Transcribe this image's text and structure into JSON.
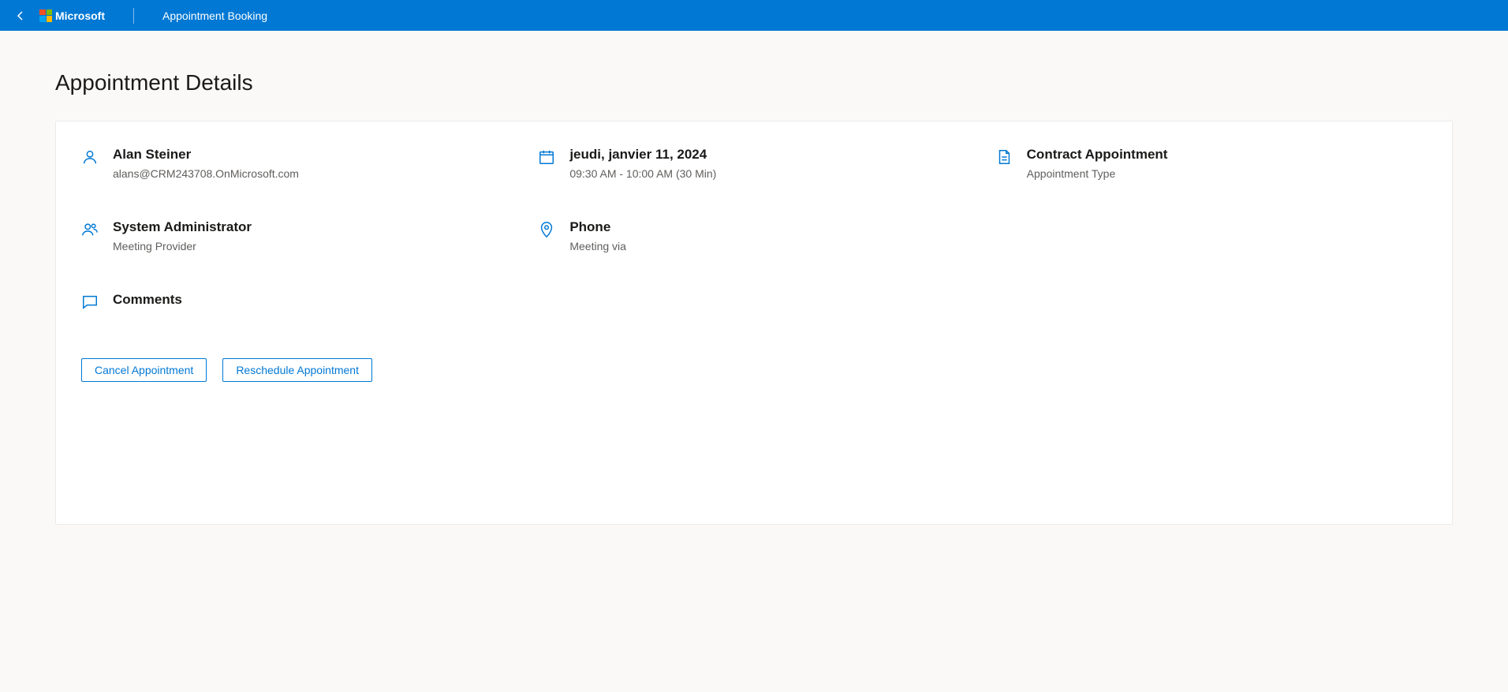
{
  "header": {
    "brand": "Microsoft",
    "title": "Appointment Booking"
  },
  "page_title": "Appointment Details",
  "details": {
    "person": {
      "name": "Alan Steiner",
      "email": "alans@CRM243708.OnMicrosoft.com"
    },
    "date": {
      "date_str": "jeudi, janvier 11, 2024",
      "time_str": "09:30 AM - 10:00 AM (30 Min)"
    },
    "type": {
      "name": "Contract Appointment",
      "label": "Appointment Type"
    },
    "provider": {
      "name": "System Administrator",
      "label": "Meeting Provider"
    },
    "location": {
      "name": "Phone",
      "label": "Meeting via"
    },
    "comments": {
      "label": "Comments"
    }
  },
  "actions": {
    "cancel": "Cancel Appointment",
    "reschedule": "Reschedule Appointment"
  }
}
